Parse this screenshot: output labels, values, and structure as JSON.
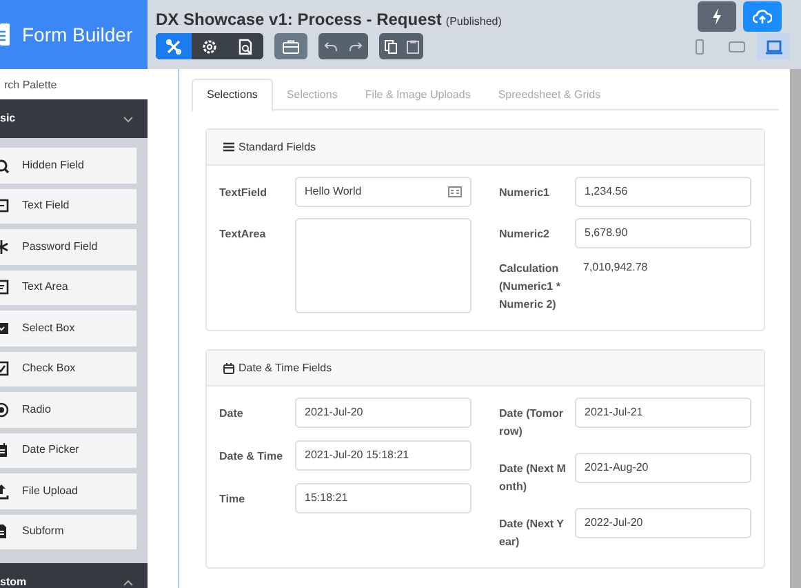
{
  "app": {
    "title": "Form Builder"
  },
  "palette": {
    "search_placeholder": "rch Palette",
    "groups": [
      {
        "label": "sic",
        "expanded": true,
        "items": [
          {
            "label": "Hidden Field",
            "kind": "hidden"
          },
          {
            "label": "Text Field",
            "kind": "textfield"
          },
          {
            "label": "Password Field",
            "kind": "password"
          },
          {
            "label": "Text Area",
            "kind": "textarea"
          },
          {
            "label": "Select Box",
            "kind": "select"
          },
          {
            "label": "Check Box",
            "kind": "check"
          },
          {
            "label": "Radio",
            "kind": "radio"
          },
          {
            "label": "Date Picker",
            "kind": "date"
          },
          {
            "label": "File Upload",
            "kind": "upload"
          },
          {
            "label": "Subform",
            "kind": "subform"
          }
        ]
      },
      {
        "label": "stom",
        "expanded": false
      }
    ]
  },
  "header": {
    "title": "DX Showcase v1: Process - Request",
    "status": "(Published)",
    "mode_tools": [
      {
        "kind": "tools",
        "selected": true
      },
      {
        "kind": "gear",
        "selected": false
      },
      {
        "kind": "preview",
        "selected": false
      }
    ],
    "devices": [
      {
        "kind": "phone",
        "selected": false
      },
      {
        "kind": "tablet",
        "selected": false
      },
      {
        "kind": "laptop",
        "selected": true
      }
    ]
  },
  "tabs": [
    {
      "label": "Selections",
      "selected": true
    },
    {
      "label": "Selections",
      "selected": false
    },
    {
      "label": "File & Image Uploads",
      "selected": false
    },
    {
      "label": "Spreedsheet & Grids",
      "selected": false
    }
  ],
  "sections": [
    {
      "title": "Standard Fields",
      "kind": "list",
      "left": [
        {
          "label": "TextField",
          "kind": "text",
          "value": "Hello World"
        },
        {
          "label": "TextArea",
          "kind": "textarea"
        }
      ],
      "right": [
        {
          "label": "Numeric1",
          "kind": "input",
          "value": "1,234.56"
        },
        {
          "label": "Numeric2",
          "kind": "input",
          "value": "5,678.90"
        },
        {
          "label": "Calculation (Numeric1 * Numeric 2)",
          "kind": "plain",
          "value": "7,010,942.78"
        }
      ]
    },
    {
      "title": "Date & Time Fields",
      "kind": "calendar",
      "left": [
        {
          "label": "Date",
          "kind": "input",
          "value": "2021-Jul-20"
        },
        {
          "label": "Date & Time",
          "kind": "input",
          "value": "2021-Jul-20 15:18:21"
        },
        {
          "label": "Time",
          "kind": "input",
          "value": "15:18:21"
        }
      ],
      "right": [
        {
          "label": "Date (Tomorrow)",
          "kind": "input",
          "value": "2021-Jul-21"
        },
        {
          "label": "Date (Next Month)",
          "kind": "input",
          "value": "2021-Aug-20"
        },
        {
          "label": "Date (Next Year)",
          "kind": "input",
          "value": "2022-Jul-20"
        }
      ]
    }
  ]
}
